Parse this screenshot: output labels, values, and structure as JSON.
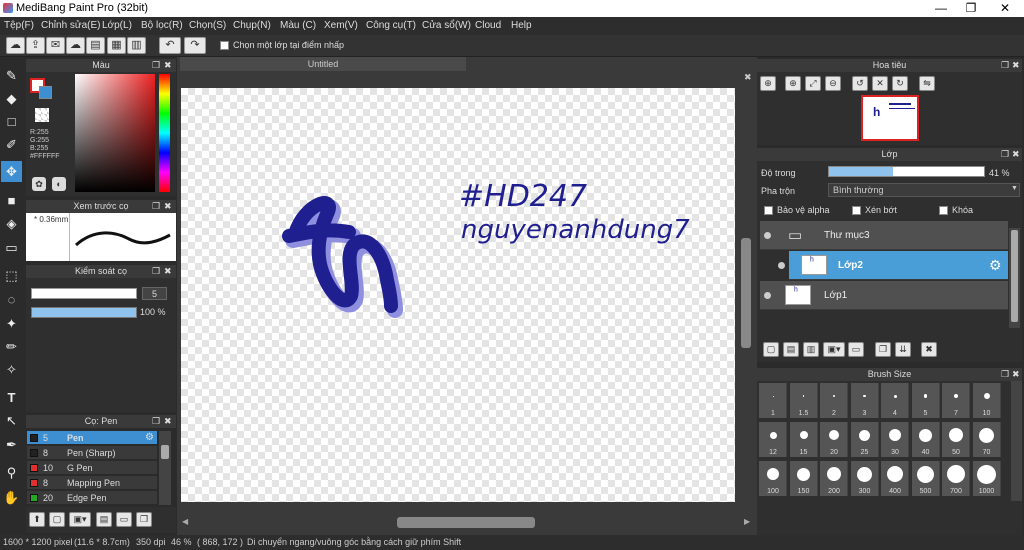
{
  "app": {
    "title": "MediBang Paint Pro (32bit)"
  },
  "window_controls": {
    "minimize": "—",
    "maximize": "❐",
    "close": "✕"
  },
  "menu": [
    "Tệp(F)",
    "Chỉnh sửa(E)",
    "Lớp(L)",
    "Bộ lọc(R)",
    "Chọn(S)",
    "Chụp(N)",
    "Màu (C)",
    "Xem(V)",
    "Công cụ(T)",
    "Cửa sổ(W)",
    "Cloud",
    "Help"
  ],
  "toolbar": {
    "select_layer_label": "Chọn một lớp tại điểm nhấp"
  },
  "color_panel": {
    "title": "Màu",
    "r": "R:255",
    "g": "G:255",
    "b": "B:255",
    "hex": "#FFFFFF",
    "primary": "#ffffff",
    "secondary": "#3d8fd1"
  },
  "preview_panel": {
    "title": "Xem trước cọ",
    "size": "0.36mm"
  },
  "brush_control": {
    "title": "Kiểm soát cọ",
    "size_value": "5",
    "opacity_value": "100 %",
    "opacity_fraction": 1.0
  },
  "brush_list": {
    "title": "Cọ: Pen",
    "items": [
      {
        "size": "5",
        "name": "Pen",
        "color": "#222222"
      },
      {
        "size": "8",
        "name": "Pen (Sharp)",
        "color": "#222222"
      },
      {
        "size": "10",
        "name": "G Pen",
        "color": "#e03030"
      },
      {
        "size": "8",
        "name": "Mapping Pen",
        "color": "#e03030"
      },
      {
        "size": "20",
        "name": "Edge Pen",
        "color": "#22aa22"
      }
    ]
  },
  "document": {
    "tab": "Untitled",
    "text_line1": "#HD247",
    "text_line2": "nguyenanhdung7",
    "ink_color": "#1f1f8f",
    "shadow_color": "#8f8fe0"
  },
  "navigator": {
    "title": "Hoa tiêu"
  },
  "layer_panel": {
    "title": "Lớp",
    "opacity_label": "Độ trong",
    "opacity_value": "41 %",
    "opacity_fraction": 0.41,
    "blend_label": "Pha trộn",
    "blend_value": "Bình thường",
    "protect_alpha": "Bảo vệ alpha",
    "clipping": "Xén bớt",
    "lock": "Khóa",
    "layers": [
      {
        "name": "Thư mục3",
        "type": "folder"
      },
      {
        "name": "Lớp2",
        "type": "layer",
        "selected": true
      },
      {
        "name": "Lớp1",
        "type": "layer"
      }
    ]
  },
  "brush_size": {
    "title": "Brush Size",
    "sizes": [
      "1",
      "1.5",
      "2",
      "3",
      "4",
      "5",
      "7",
      "10",
      "12",
      "15",
      "20",
      "25",
      "30",
      "40",
      "50",
      "70",
      "100",
      "150",
      "200",
      "300",
      "400",
      "500",
      "700",
      "1000"
    ]
  },
  "status": {
    "pixels": "1600 * 1200 pixel",
    "physical": "(11.6 * 8.7cm)",
    "dpi": "350 dpi",
    "zoom": "46 %",
    "coords": "( 868, 172 )",
    "hint": "Di chuyển ngang/vuông góc bằng cách giữ phím Shift"
  }
}
